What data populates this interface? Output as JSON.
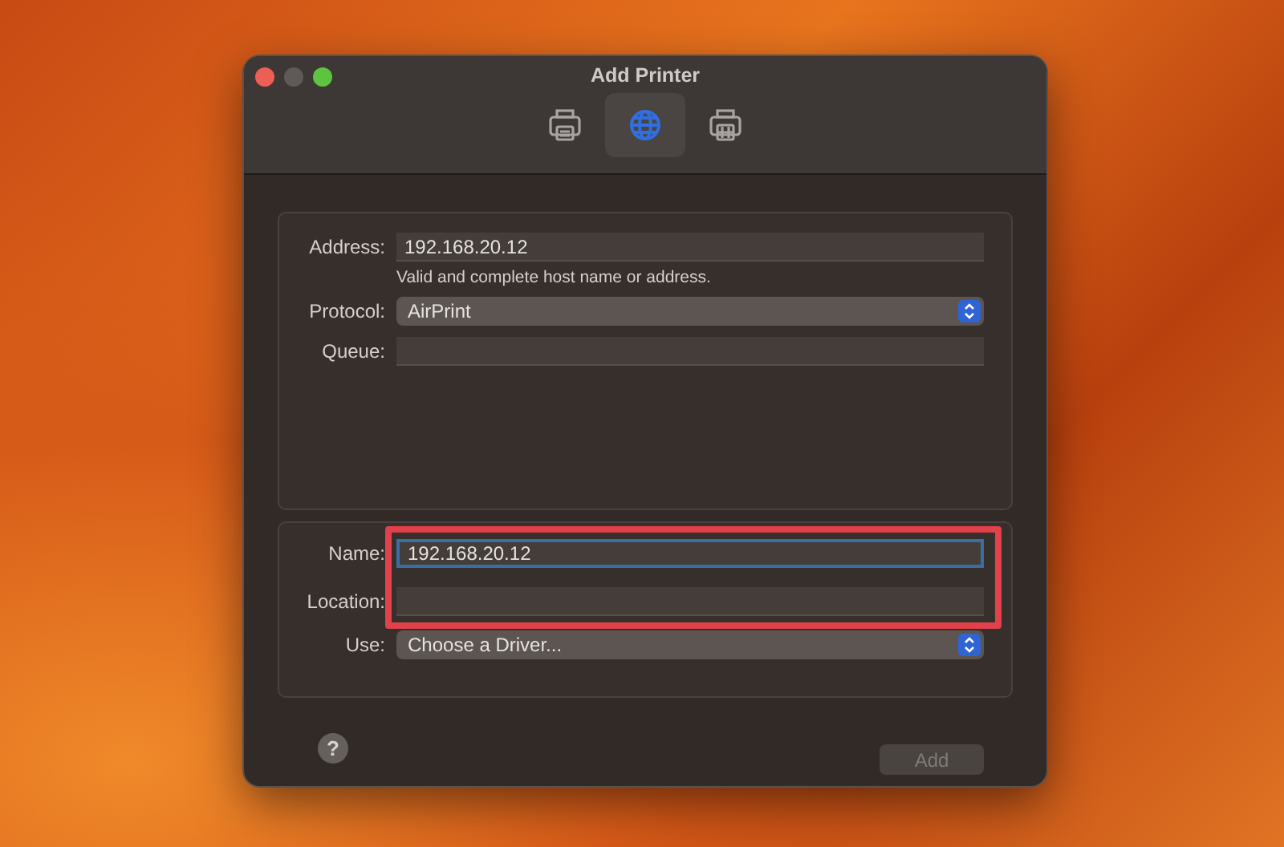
{
  "window": {
    "title": "Add Printer"
  },
  "toolbar": [
    {
      "kind": "local",
      "selected": false
    },
    {
      "kind": "ip",
      "selected": true
    },
    {
      "kind": "windows",
      "selected": false
    }
  ],
  "sections": [
    {
      "fields": [
        {
          "kind": "text",
          "label": "Address:",
          "value": "192.168.20.12",
          "focused": false
        },
        {
          "kind": "hint",
          "text": "Valid and complete host name or address."
        },
        {
          "kind": "popup",
          "label": "Protocol:",
          "value": "AirPrint"
        },
        {
          "kind": "text",
          "label": "Queue:",
          "focused": false
        }
      ]
    },
    {
      "fields": [
        {
          "kind": "text",
          "label": "Name:",
          "value": "192.168.20.12",
          "focused": true,
          "highlighted": true
        },
        {
          "kind": "text",
          "label": "Location:",
          "focused": false,
          "highlighted": true
        },
        {
          "kind": "popup",
          "label": "Use:",
          "value": "Choose a Driver..."
        }
      ]
    }
  ],
  "help_button": {
    "label": "?"
  },
  "add_button": {
    "label": "Add",
    "disabled": true
  }
}
